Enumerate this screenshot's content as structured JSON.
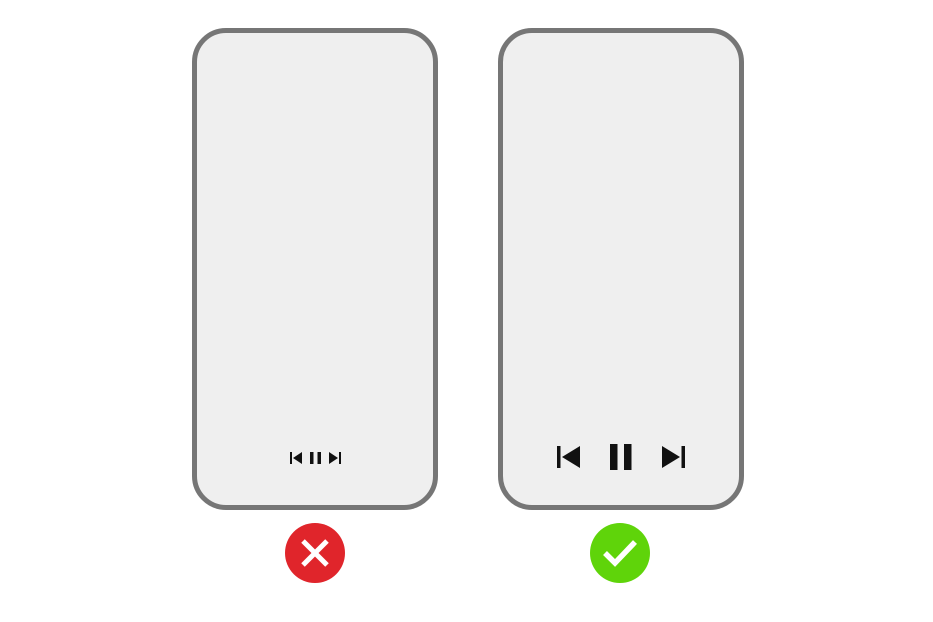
{
  "examples": [
    {
      "id": "bad",
      "verdict": "incorrect",
      "controls_size": "small",
      "controls": [
        "skip-previous-icon",
        "pause-icon",
        "skip-next-icon"
      ],
      "badge_icon": "x-mark-icon"
    },
    {
      "id": "good",
      "verdict": "correct",
      "controls_size": "large",
      "controls": [
        "skip-previous-icon",
        "pause-icon",
        "skip-next-icon"
      ],
      "badge_icon": "check-mark-icon"
    }
  ],
  "colors": {
    "phone_border": "#767676",
    "phone_screen": "#efefef",
    "icon": "#111111",
    "badge_incorrect": "#e0252b",
    "badge_correct": "#5fd40a",
    "badge_glyph": "#ffffff"
  }
}
